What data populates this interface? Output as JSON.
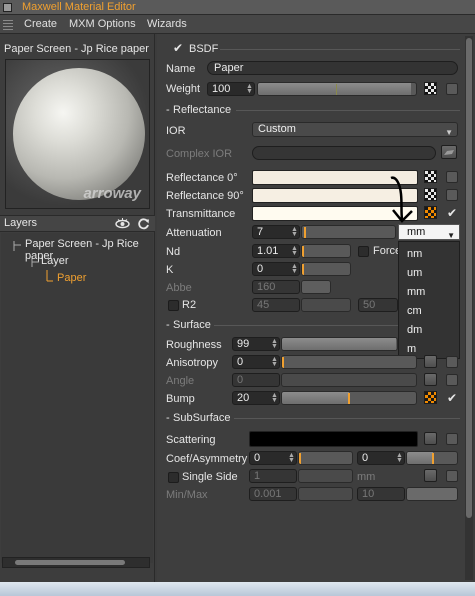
{
  "window": {
    "title": "Maxwell Material Editor"
  },
  "menubar": {
    "items": [
      "Create",
      "MXM Options",
      "Wizards"
    ]
  },
  "left": {
    "material_name": "Paper Screen - Jp Rice paper",
    "preview_watermark": "arroway",
    "layers_label": "Layers",
    "tree": [
      {
        "label": "Paper Screen - Jp Rice paper",
        "level": 0,
        "selected": false
      },
      {
        "label": "Layer",
        "level": 1,
        "selected": false
      },
      {
        "label": "Paper",
        "level": 2,
        "selected": true
      }
    ]
  },
  "bsdf": {
    "header": "BSDF",
    "name_label": "Name",
    "name_value": "Paper",
    "weight_label": "Weight",
    "weight_value": "100",
    "reflectance": {
      "header": "Reflectance",
      "ior_label": "IOR",
      "ior_value": "Custom",
      "complex_ior_label": "Complex IOR",
      "refl0_label": "Reflectance 0°",
      "refl90_label": "Reflectance 90°",
      "transmittance_label": "Transmittance",
      "attenuation_label": "Attenuation",
      "attenuation_value": "7",
      "attenuation_unit": "mm",
      "nd_label": "Nd",
      "nd_value": "1.01",
      "force_label": "Force",
      "k_label": "K",
      "k_value": "0",
      "abbe_label": "Abbe",
      "abbe_value": "160",
      "r2_label": "R2",
      "r2_value_a": "45",
      "r2_value_b": "50",
      "unit_options": [
        "nm",
        "um",
        "mm",
        "cm",
        "dm",
        "m"
      ]
    },
    "surface": {
      "header": "Surface",
      "roughness_label": "Roughness",
      "roughness_value": "99",
      "anisotropy_label": "Anisotropy",
      "anisotropy_value": "0",
      "angle_label": "Angle",
      "angle_value": "0",
      "bump_label": "Bump",
      "bump_value": "20"
    },
    "subsurface": {
      "header": "SubSurface",
      "scattering_label": "Scattering",
      "coef_label": "Coef/Asymmetry",
      "coef_value": "0",
      "asym_value": "0",
      "single_side_label": "Single Side",
      "single_side_value": "1",
      "single_side_unit": "mm",
      "minmax_label": "Min/Max",
      "min_value": "0.001",
      "max_value": "10"
    }
  },
  "colors": {
    "accent_orange": "#f0a030",
    "reflectance0": "#f3ece0",
    "reflectance90": "#f6efe3",
    "transmittance": "#fffbf0",
    "scattering": "#000000"
  },
  "sliders": {
    "weight_fill": 0.97,
    "roughness_fill": 0.99,
    "bump_fill": 0.5
  }
}
